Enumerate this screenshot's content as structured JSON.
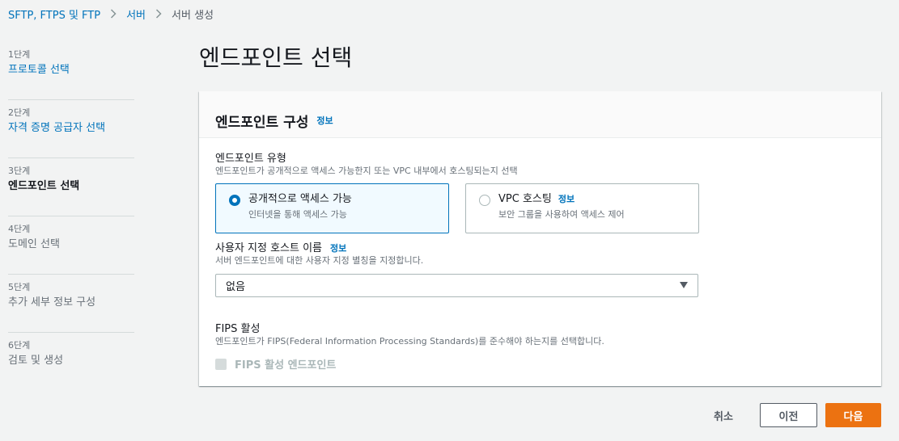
{
  "breadcrumb": {
    "items": [
      "SFTP, FTPS 및 FTP",
      "서버",
      "서버 생성"
    ]
  },
  "steps": [
    {
      "num": "1단계",
      "label": "프로토콜 선택",
      "state": "link"
    },
    {
      "num": "2단계",
      "label": "자격 증명 공급자 선택",
      "state": "link"
    },
    {
      "num": "3단계",
      "label": "엔드포인트 선택",
      "state": "current"
    },
    {
      "num": "4단계",
      "label": "도메인 선택",
      "state": "disabled"
    },
    {
      "num": "5단계",
      "label": "추가 세부 정보 구성",
      "state": "disabled"
    },
    {
      "num": "6단계",
      "label": "검토 및 생성",
      "state": "disabled"
    }
  ],
  "page": {
    "title": "엔드포인트 선택"
  },
  "container": {
    "title": "엔드포인트 구성",
    "info": "정보"
  },
  "endpoint_type": {
    "label": "엔드포인트 유형",
    "description": "엔드포인트가 공개적으로 액세스 가능한지 또는 VPC 내부에서 호스팅되는지 선택",
    "options": [
      {
        "title": "공개적으로 액세스 가능",
        "description": "인터넷을 통해 액세스 가능",
        "selected": true
      },
      {
        "title": "VPC 호스팅",
        "info": "정보",
        "description": "보안 그룹을 사용하여 액세스 제어",
        "selected": false
      }
    ]
  },
  "hostname": {
    "label": "사용자 지정 호스트 이름",
    "info": "정보",
    "description": "서버 엔드포인트에 대한 사용자 지정 별칭을 지정합니다.",
    "selected_value": "없음"
  },
  "fips": {
    "label": "FIPS 활성",
    "description": "엔드포인트가 FIPS(Federal Information Processing Standards)를 준수해야 하는지를 선택합니다.",
    "checkbox_label": "FIPS 활성 엔드포인트",
    "checked": false,
    "disabled": true
  },
  "footer": {
    "cancel_label": "취소",
    "previous_label": "이전",
    "next_label": "다음"
  },
  "colors": {
    "link": "#0073bb",
    "primary_button": "#ec7211",
    "selected_tile_bg": "#f1faff"
  }
}
